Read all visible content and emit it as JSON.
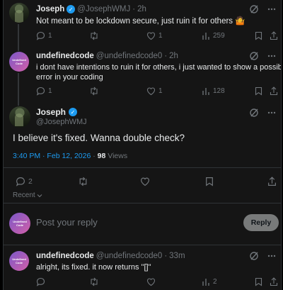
{
  "tweets": [
    {
      "name": "Joseph",
      "handle": "@JosephWMJ",
      "dot": "·",
      "time": "2h",
      "text": "Not meant to be lockdown secure, just ruin it for others 🤷",
      "replies": "1",
      "likes": "1",
      "views": "259"
    },
    {
      "name": "undefinedcode",
      "handle": "@undefinedcode0",
      "dot": "·",
      "time": "2h",
      "text_line1": "i dont have intentions to ruin it for others, i just wanted to show a possible",
      "text_line2": "error in your coding",
      "replies": "1",
      "likes": "1",
      "views": "128"
    }
  ],
  "focus": {
    "name": "Joseph",
    "handle": "@JosephWMJ",
    "text": "I believe it's fixed. Wanna double check?",
    "time": "3:40 PM · Feb 12, 2026",
    "dot": "·",
    "views_count": "98",
    "views_label": "Views",
    "replies": "2"
  },
  "sort": {
    "label": "Recent"
  },
  "composer": {
    "placeholder": "Post your reply",
    "button": "Reply"
  },
  "last_reply": {
    "name": "undefinedcode",
    "handle": "@undefinedcode0",
    "dot": "·",
    "time": "33m",
    "text": "alright, its fixed. it now returns \"[]\"",
    "views": "2"
  },
  "avatar_label": "Undefined Code",
  "colors": {
    "accent": "#1d9bf0",
    "muted": "#71767b",
    "bg": "#151515"
  }
}
